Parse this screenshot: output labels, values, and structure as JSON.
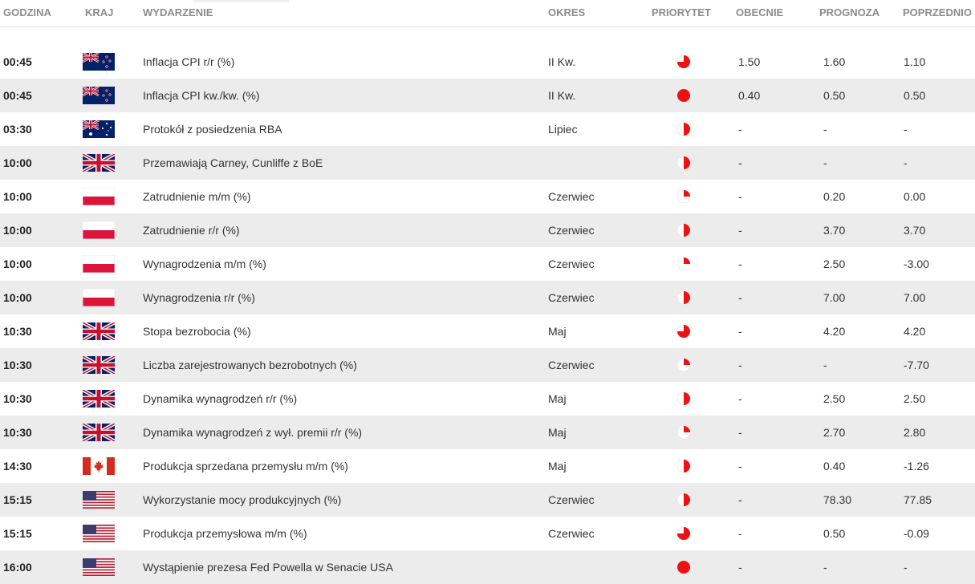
{
  "header": {
    "time": "GODZINA",
    "country": "KRAJ",
    "event": "WYDARZENIE",
    "period": "OKRES",
    "priority": "PRIORYTET",
    "actual": "OBECNIE",
    "forecast": "PROGNOZA",
    "previous": "POPRZEDNIO"
  },
  "colors": {
    "priority": "#ee1111",
    "header_text": "#8c8c8c",
    "row_alt": "#ececec"
  },
  "rows": [
    {
      "time": "00:45",
      "country": "nz",
      "event": "Inflacja CPI r/r (%)",
      "period": "II Kw.",
      "priority": 0.75,
      "actual": "1.50",
      "forecast": "1.60",
      "previous": "1.10"
    },
    {
      "time": "00:45",
      "country": "nz",
      "event": "Inflacja CPI kw./kw. (%)",
      "period": "II Kw.",
      "priority": 1.0,
      "actual": "0.40",
      "forecast": "0.50",
      "previous": "0.50"
    },
    {
      "time": "03:30",
      "country": "au",
      "event": "Protokół z posiedzenia RBA",
      "period": "Lipiec",
      "priority": 0.5,
      "actual": "-",
      "forecast": "-",
      "previous": "-"
    },
    {
      "time": "10:00",
      "country": "gb",
      "event": "Przemawiają Carney, Cunliffe z BoE",
      "period": "",
      "priority": 0.5,
      "actual": "-",
      "forecast": "-",
      "previous": "-"
    },
    {
      "time": "10:00",
      "country": "pl",
      "event": "Zatrudnienie m/m (%)",
      "period": "Czerwiec",
      "priority": 0.25,
      "actual": "-",
      "forecast": "0.20",
      "previous": "0.00"
    },
    {
      "time": "10:00",
      "country": "pl",
      "event": "Zatrudnienie r/r (%)",
      "period": "Czerwiec",
      "priority": 0.5,
      "actual": "-",
      "forecast": "3.70",
      "previous": "3.70"
    },
    {
      "time": "10:00",
      "country": "pl",
      "event": "Wynagrodzenia m/m (%)",
      "period": "Czerwiec",
      "priority": 0.25,
      "actual": "-",
      "forecast": "2.50",
      "previous": "-3.00"
    },
    {
      "time": "10:00",
      "country": "pl",
      "event": "Wynagrodzenia r/r (%)",
      "period": "Czerwiec",
      "priority": 0.5,
      "actual": "-",
      "forecast": "7.00",
      "previous": "7.00"
    },
    {
      "time": "10:30",
      "country": "gb",
      "event": "Stopa bezrobocia (%)",
      "period": "Maj",
      "priority": 0.75,
      "actual": "-",
      "forecast": "4.20",
      "previous": "4.20"
    },
    {
      "time": "10:30",
      "country": "gb",
      "event": "Liczba zarejestrowanych bezrobotnych (%)",
      "period": "Czerwiec",
      "priority": 0.25,
      "actual": "-",
      "forecast": "-",
      "previous": "-7.70"
    },
    {
      "time": "10:30",
      "country": "gb",
      "event": "Dynamika wynagrodzeń r/r (%)",
      "period": "Maj",
      "priority": 0.5,
      "actual": "-",
      "forecast": "2.50",
      "previous": "2.50"
    },
    {
      "time": "10:30",
      "country": "gb",
      "event": "Dynamika wynagrodzeń z wył. premii r/r (%)",
      "period": "Maj",
      "priority": 0.25,
      "actual": "-",
      "forecast": "2.70",
      "previous": "2.80"
    },
    {
      "time": "14:30",
      "country": "ca",
      "event": "Produkcja sprzedana przemysłu m/m (%)",
      "period": "Maj",
      "priority": 0.5,
      "actual": "-",
      "forecast": "0.40",
      "previous": "-1.26"
    },
    {
      "time": "15:15",
      "country": "us",
      "event": "Wykorzystanie mocy produkcyjnych (%)",
      "period": "Czerwiec",
      "priority": 0.5,
      "actual": "-",
      "forecast": "78.30",
      "previous": "77.85"
    },
    {
      "time": "15:15",
      "country": "us",
      "event": "Produkcja przemysłowa m/m (%)",
      "period": "Czerwiec",
      "priority": 0.75,
      "actual": "-",
      "forecast": "0.50",
      "previous": "-0.09"
    },
    {
      "time": "16:00",
      "country": "us",
      "event": "Wystąpienie prezesa Fed Powella w Senacie USA",
      "period": "",
      "priority": 1.0,
      "actual": "-",
      "forecast": "-",
      "previous": "-"
    }
  ]
}
